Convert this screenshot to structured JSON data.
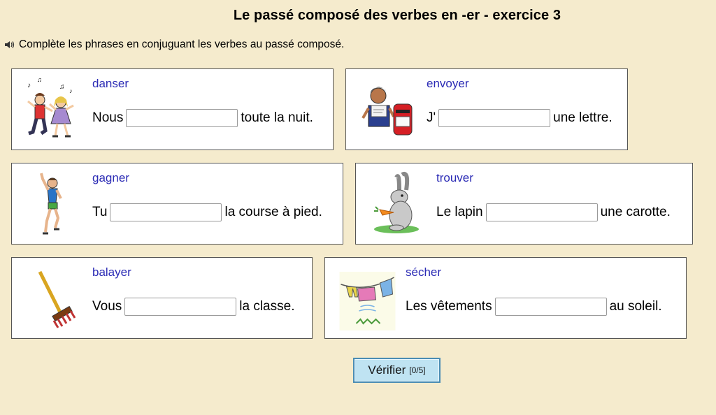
{
  "title": "Le passé composé des verbes en -er - exercice 3",
  "instruction": "Complète les phrases en conjuguant les verbes au passé composé.",
  "exercises": [
    {
      "verb": "danser",
      "before": "Nous",
      "after": "toute la nuit.",
      "icon": "dancing-children-icon",
      "value": ""
    },
    {
      "verb": "envoyer",
      "before": "J'",
      "after": "une lettre.",
      "icon": "boy-mailbox-icon",
      "value": ""
    },
    {
      "verb": "gagner",
      "before": "Tu",
      "after": "la course à pied.",
      "icon": "runner-icon",
      "value": ""
    },
    {
      "verb": "trouver",
      "before": "Le lapin",
      "after": "une carotte.",
      "icon": "rabbit-carrot-icon",
      "value": ""
    },
    {
      "verb": "balayer",
      "before": "Vous",
      "after": "la classe.",
      "icon": "broom-icon",
      "value": ""
    },
    {
      "verb": "sécher",
      "before": "Les vêtements",
      "after": "au soleil.",
      "icon": "clothesline-icon",
      "value": ""
    }
  ],
  "check_button": {
    "label": "Vérifier",
    "score": "[0/5]"
  },
  "colors": {
    "background": "#f5ebcd",
    "verb": "#2b2bb5",
    "button": "#bfe3f2"
  }
}
